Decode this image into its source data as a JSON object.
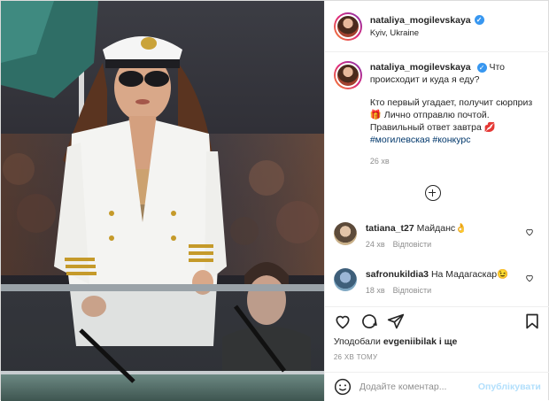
{
  "header": {
    "username": "nataliya_mogilevskaya",
    "verified_icon": "verified-badge-icon",
    "location": "Kyiv, Ukraine"
  },
  "caption": {
    "username": "nataliya_mogilevskaya",
    "line1": "Что происходит и куда я еду?",
    "line2_a": "Кто первый угадает, получит сюрприз 🎁 Лично отправлю почтой. Правильный ответ завтра 💋",
    "hashtags": "#могилевская #конкурс",
    "time": "26 хв"
  },
  "load_more_icon": "plus-circle-icon",
  "comments": [
    {
      "username": "tatiana_t27",
      "text": "Майданс👌",
      "time": "24 хв",
      "reply": "Відповісти"
    },
    {
      "username": "safronukildia3",
      "text": "На Мадагаскар😉",
      "time": "18 хв",
      "reply": "Відповісти"
    }
  ],
  "actions": {
    "likes_prefix": "Уподобали",
    "likes_user": "evgeniibilak",
    "likes_suffix": "і ще",
    "date": "26 ХВ ТОМУ"
  },
  "add_comment": {
    "placeholder": "Додайте коментар...",
    "post_label": "Опублікувати"
  },
  "colors": {
    "accent_blue": "#3897f0",
    "post_disabled": "#b2dffc",
    "hashtag": "#00376b",
    "muted": "#8e8e8e"
  }
}
